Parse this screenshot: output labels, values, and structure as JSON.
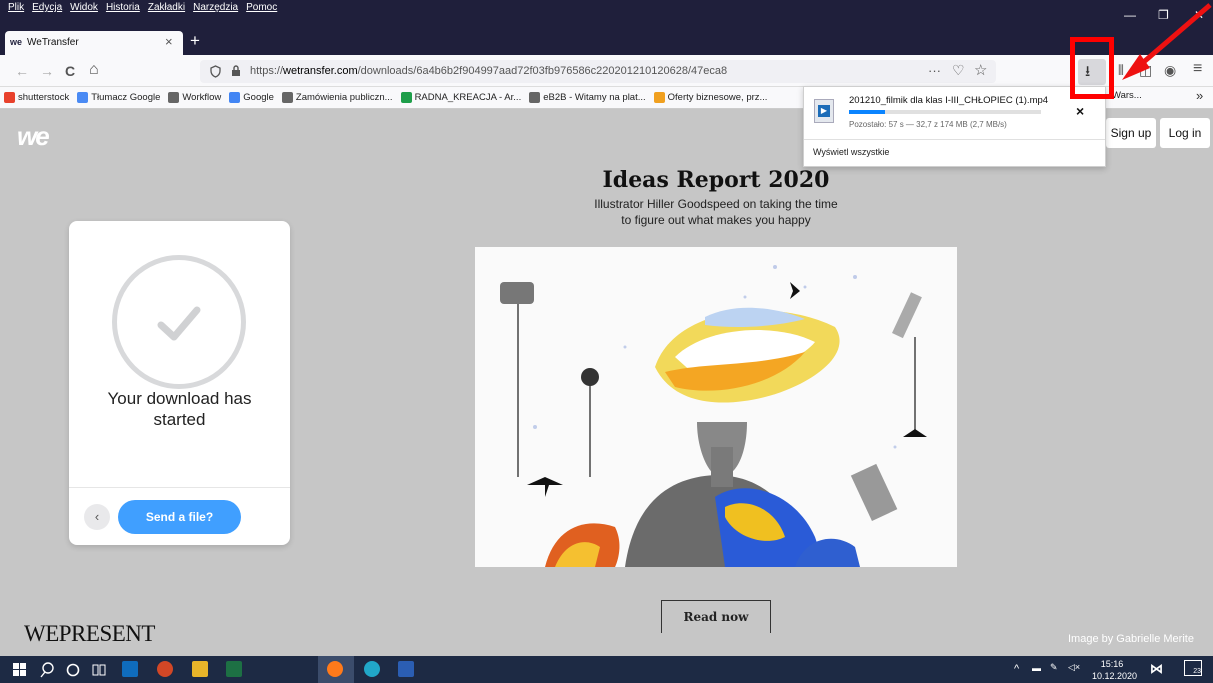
{
  "menubar": {
    "items": [
      "Plik",
      "Edycja",
      "Widok",
      "Historia",
      "Zakładki",
      "Narzędzia",
      "Pomoc"
    ]
  },
  "tab": {
    "favicon": "we",
    "title": "WeTransfer",
    "close": "×"
  },
  "newtab": "+",
  "window": {
    "minimize": "—",
    "restore": "❐",
    "close": "✕"
  },
  "nav": {
    "back": "←",
    "forward": "→",
    "reload": "C",
    "home": "⌂",
    "url_prefix": "https://",
    "url_domain": "wetransfer.com",
    "url_path": "/downloads/6a4b6b2f904997aad72f03fb976586c220201210120628/47eca8",
    "more": "···",
    "pocket": "♡",
    "star": "☆",
    "download": "⭳",
    "library": "⫴",
    "sidebar": "◫",
    "account": "◉",
    "menu": "≡"
  },
  "bookmarks": [
    {
      "label": "shutterstock",
      "color": "#e8412c"
    },
    {
      "label": "Tłumacz Google",
      "color": "#4a8af4"
    },
    {
      "label": "Workflow",
      "color": "#666666"
    },
    {
      "label": "Google",
      "color": "#4285f4"
    },
    {
      "label": "Zamówienia publiczn...",
      "color": "#666666"
    },
    {
      "label": "RADNA_KREACJA - Ar...",
      "color": "#1e9e4a"
    },
    {
      "label": "eB2B - Witamy na plat...",
      "color": "#666666"
    },
    {
      "label": "Oferty biznesowe, prz...",
      "color": "#f0a020"
    }
  ],
  "bookmark_extra": "Wars...",
  "bookmark_more": "»",
  "page": {
    "logo": "we",
    "card": {
      "line1": "Your download has",
      "line2": "started",
      "back": "‹",
      "send": "Send a file?"
    },
    "ideas": {
      "title": "Ideas Report 2020",
      "sub1": "Illustrator Hiller Goodspeed on taking the time",
      "sub2": "to figure out what makes you happy"
    },
    "readnow": "Read now",
    "wepresent": "WEPRESENT",
    "credit": "Image by Gabrielle Merite",
    "signup": "Sign up",
    "login": "Log in"
  },
  "downloads": {
    "filename": "201210_filmik dla klas I-III_CHŁOPIEC (1).mp4",
    "status": "Pozostało: 57 s — 32,7 z 174 MB (2,7 MB/s)",
    "progress": 0.19,
    "close": "×",
    "show_all": "Wyświetl wszystkie"
  },
  "taskbar": {
    "time": "15:16",
    "date": "10.12.2020",
    "notif": "23"
  },
  "colors": {
    "accent": "#409fff",
    "firefox_dark": "#1f1f3b",
    "highlight": "#ff0000"
  }
}
